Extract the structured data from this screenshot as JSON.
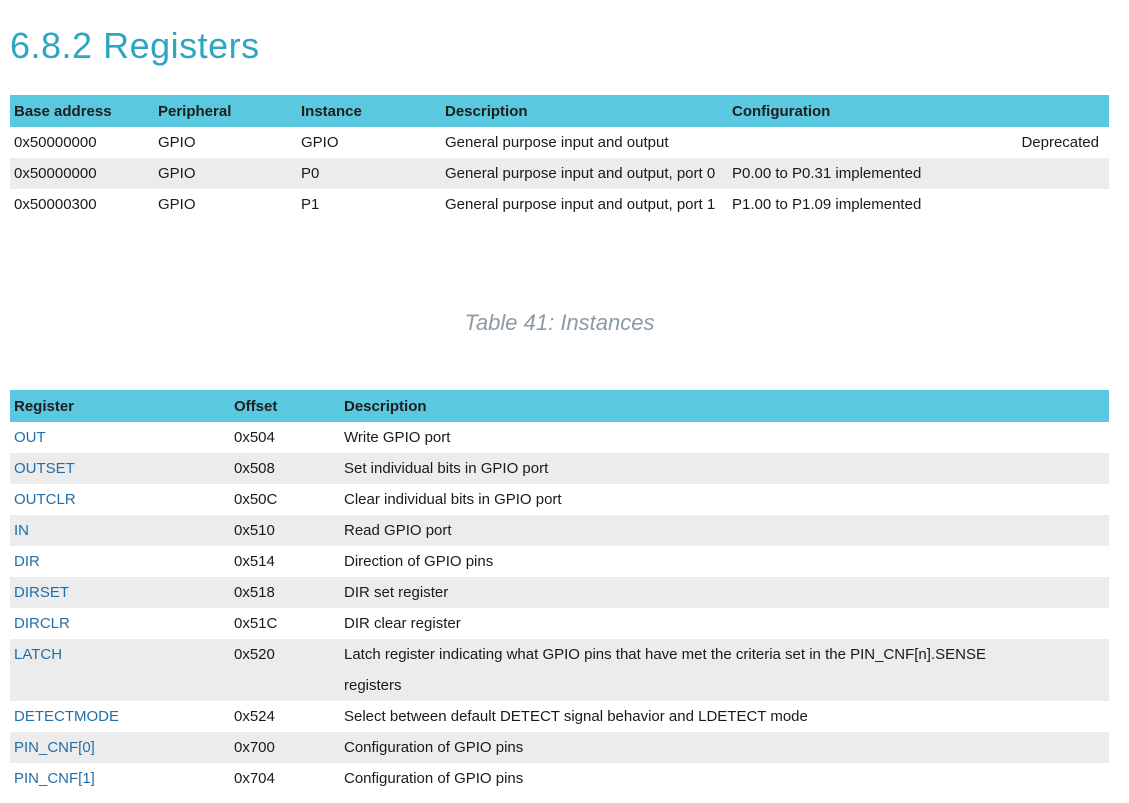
{
  "page_title": "6.8.2 Registers",
  "instances_table": {
    "headers": [
      "Base address",
      "Peripheral",
      "Instance",
      "Description",
      "Configuration",
      ""
    ],
    "rows": [
      {
        "base": "0x50000000",
        "peripheral": "GPIO",
        "instance": "GPIO",
        "description": "General purpose input and output",
        "configuration": "",
        "note": "Deprecated"
      },
      {
        "base": "0x50000000",
        "peripheral": "GPIO",
        "instance": "P0",
        "description": "General purpose input and output, port 0",
        "configuration": "P0.00 to P0.31 implemented",
        "note": ""
      },
      {
        "base": "0x50000300",
        "peripheral": "GPIO",
        "instance": "P1",
        "description": "General purpose input and output, port 1",
        "configuration": "P1.00 to P1.09 implemented",
        "note": ""
      }
    ],
    "caption": "Table 41: Instances"
  },
  "registers_table": {
    "headers": [
      "Register",
      "Offset",
      "Description"
    ],
    "rows": [
      {
        "register": "OUT",
        "offset": "0x504",
        "description": "Write GPIO port"
      },
      {
        "register": "OUTSET",
        "offset": "0x508",
        "description": "Set individual bits in GPIO port"
      },
      {
        "register": "OUTCLR",
        "offset": "0x50C",
        "description": "Clear individual bits in GPIO port"
      },
      {
        "register": "IN",
        "offset": "0x510",
        "description": "Read GPIO port"
      },
      {
        "register": "DIR",
        "offset": "0x514",
        "description": "Direction of GPIO pins"
      },
      {
        "register": "DIRSET",
        "offset": "0x518",
        "description": "DIR set register"
      },
      {
        "register": "DIRCLR",
        "offset": "0x51C",
        "description": "DIR clear register"
      },
      {
        "register": "LATCH",
        "offset": "0x520",
        "description": "Latch register indicating what GPIO pins that have met the criteria set in the PIN_CNF[n].SENSE registers"
      },
      {
        "register": "DETECTMODE",
        "offset": "0x524",
        "description": "Select between default DETECT signal behavior and LDETECT mode"
      },
      {
        "register": "PIN_CNF[0]",
        "offset": "0x700",
        "description": "Configuration of GPIO pins"
      },
      {
        "register": "PIN_CNF[1]",
        "offset": "0x704",
        "description": "Configuration of GPIO pins"
      }
    ]
  },
  "colors": {
    "title": "#2ea6c2",
    "header_bg": "#5ac8df",
    "alt_row_bg": "#ececec",
    "link": "#1f6fa8",
    "caption": "#8c9aa4"
  }
}
